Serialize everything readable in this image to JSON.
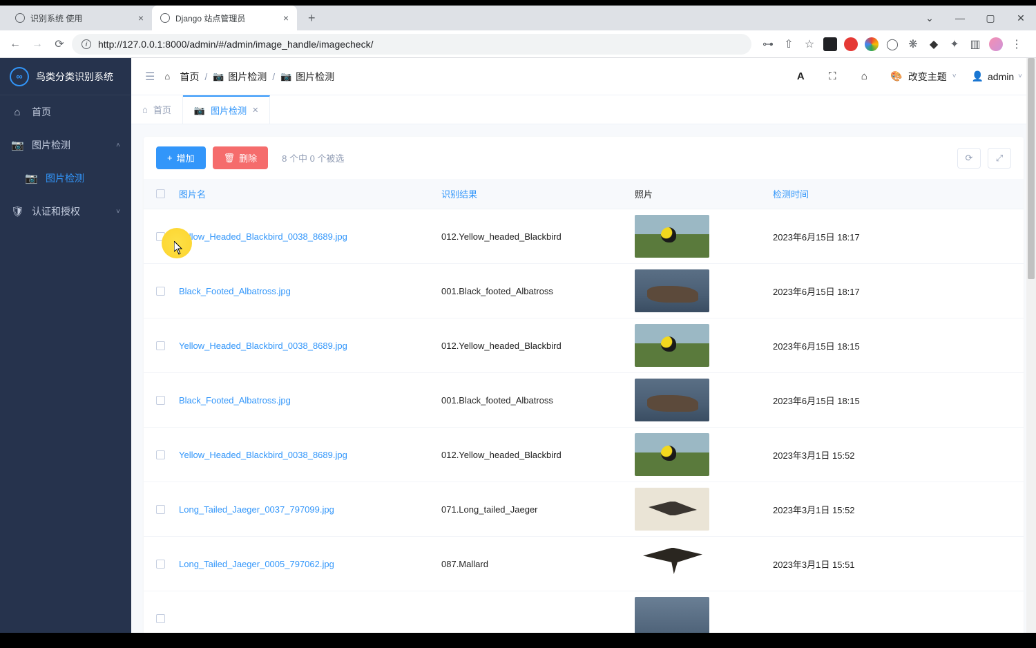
{
  "browser": {
    "tabs": [
      {
        "label": "识别系统 使用",
        "active": false
      },
      {
        "label": "Django 站点管理员",
        "active": true
      }
    ],
    "url": "http://127.0.0.1:8000/admin/#/admin/image_handle/imagecheck/"
  },
  "sidebar": {
    "brand": "鸟类分类识别系统",
    "items": [
      {
        "icon": "home",
        "label": "首页"
      },
      {
        "icon": "camera",
        "label": "图片检测",
        "expanded": true,
        "children": [
          {
            "icon": "camera",
            "label": "图片检测",
            "active": true
          }
        ]
      },
      {
        "icon": "shield",
        "label": "认证和授权",
        "expanded": false
      }
    ]
  },
  "topbar": {
    "breadcrumb": [
      {
        "icon": "home",
        "label": "首页"
      },
      {
        "icon": "camera",
        "label": "图片检测"
      },
      {
        "icon": "camera",
        "label": "图片检测"
      }
    ],
    "theme_label": "改变主题",
    "user": "admin"
  },
  "content_tabs": [
    {
      "icon": "home",
      "label": "首页",
      "active": false,
      "closable": false
    },
    {
      "icon": "camera",
      "label": "图片检测",
      "active": true,
      "closable": true
    }
  ],
  "toolbar": {
    "add_label": "增加",
    "delete_label": "删除",
    "selection_text": "8 个中 0 个被选"
  },
  "table": {
    "columns": {
      "filename": "图片名",
      "result": "识别结果",
      "photo": "照片",
      "time": "检测时间"
    },
    "rows": [
      {
        "filename": "Yellow_Headed_Blackbird_0038_8689.jpg",
        "result": "012.Yellow_headed_Blackbird",
        "img": "blackbird",
        "time": "2023年6月15日 18:17"
      },
      {
        "filename": "Black_Footed_Albatross.jpg",
        "result": "001.Black_footed_Albatross",
        "img": "albatross",
        "time": "2023年6月15日 18:17"
      },
      {
        "filename": "Yellow_Headed_Blackbird_0038_8689.jpg",
        "result": "012.Yellow_headed_Blackbird",
        "img": "blackbird",
        "time": "2023年6月15日 18:15"
      },
      {
        "filename": "Black_Footed_Albatross.jpg",
        "result": "001.Black_footed_Albatross",
        "img": "albatross",
        "time": "2023年6月15日 18:15"
      },
      {
        "filename": "Yellow_Headed_Blackbird_0038_8689.jpg",
        "result": "012.Yellow_headed_Blackbird",
        "img": "blackbird",
        "time": "2023年3月1日 15:52"
      },
      {
        "filename": "Long_Tailed_Jaeger_0037_797099.jpg",
        "result": "071.Long_tailed_Jaeger",
        "img": "jaeger1",
        "time": "2023年3月1日 15:52"
      },
      {
        "filename": "Long_Tailed_Jaeger_0005_797062.jpg",
        "result": "087.Mallard",
        "img": "jaeger2",
        "time": "2023年3月1日 15:51"
      },
      {
        "filename": "",
        "result": "",
        "img": "default",
        "time": ""
      }
    ]
  }
}
